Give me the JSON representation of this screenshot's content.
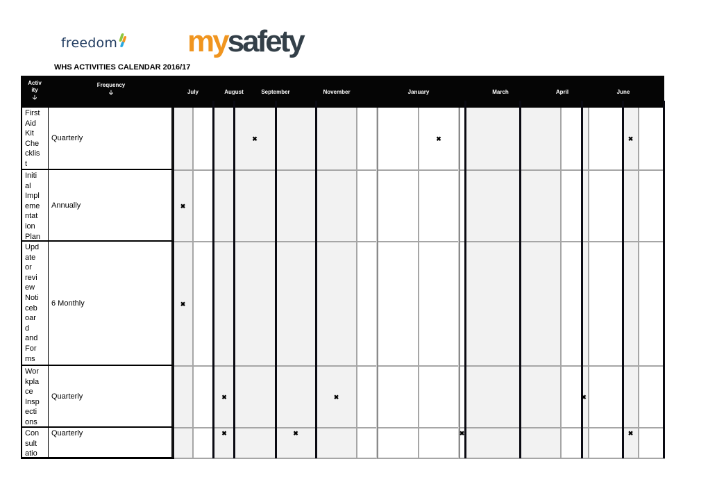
{
  "logos": {
    "freedom": "freedom",
    "mysafety_my": "my",
    "mysafety_safety": "safety"
  },
  "brand_colors": {
    "mysafety_orange": "#f0951f",
    "mysafety_dark": "#333f48",
    "freedom_navy": "#1f3a5f",
    "header_band": "#050505",
    "shaded_cell": "#f2f2f2"
  },
  "title": "WHS ACTIVITIES CALENDAR 2016/17",
  "header": {
    "activity_label": "Activ ity",
    "activity_label_line1": "Activ",
    "activity_label_line2": "ity",
    "frequency_label": "Frequency",
    "arrow_icon": "🡣",
    "months": [
      "July",
      "August",
      "September",
      "November",
      "January",
      "March",
      "April",
      "June"
    ]
  },
  "mark_symbol": "✖",
  "rows": [
    {
      "activity": "First Aid Kit Checklist",
      "activity_wrapped": "First\nAid\nKit\nChe\ncklis\nt",
      "frequency": "Quarterly",
      "marked_columns": [
        3,
        8,
        15
      ]
    },
    {
      "activity": "Initial Implementation Plan",
      "activity_wrapped": "Initi\nal\nImpl\neme\nntat\nion\nPlan",
      "frequency": "Annually",
      "marked_columns": [
        0
      ]
    },
    {
      "activity": "Update or review Noticeboard and Forms",
      "activity_wrapped": "Upd\nate\nor\nrevi\new\nNoti\nceb\noar\nd\nand\nFor\nms",
      "frequency": "6 Monthly",
      "marked_columns": [
        0
      ]
    },
    {
      "activity": "Workplace Inspections",
      "activity_wrapped": "Wor\nkpla\nce\nInsp\necti\nons",
      "frequency": "Quarterly",
      "marked_columns": [
        2,
        5,
        13
      ]
    },
    {
      "activity": "Consultation",
      "activity_wrapped": "Con\nsult\natio",
      "frequency": "Quarterly",
      "marked_columns": [
        2,
        4,
        9,
        15
      ]
    }
  ]
}
